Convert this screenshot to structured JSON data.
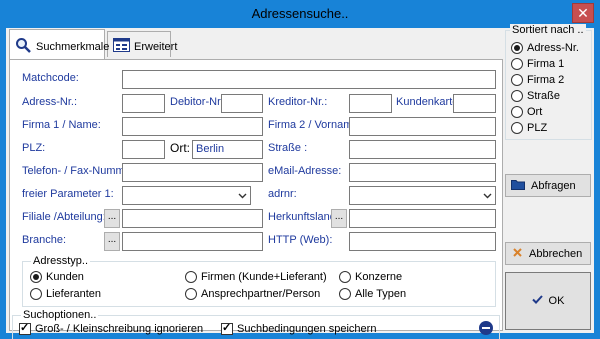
{
  "window": {
    "title": "Adressensuche..",
    "close_symbol": "✕"
  },
  "tabs": [
    {
      "label": "Suchmerkmale",
      "icon": "search-icon",
      "active": true
    },
    {
      "label": "Erweitert",
      "icon": "form-icon",
      "active": false
    }
  ],
  "form": {
    "matchcode_label": "Matchcode:",
    "adressnr_label": "Adress-Nr.:",
    "debitor_label": "Debitor-Nr:",
    "kreditor_label": "Kreditor-Nr.:",
    "kundenkarte_label": "Kundenkarte:",
    "firma1_label": "Firma 1 / Name:",
    "firma2_label": "Firma 2 / Vorname:",
    "plz_label": "PLZ:",
    "ort_label": "Ort:",
    "ort_value": "Berlin",
    "strasse_label": "Straße :",
    "telefon_label": "Telefon- / Fax-Nummer:",
    "email_label": "eMail-Adresse:",
    "freier_label": "freier Parameter 1:",
    "adrnr_label": "adrnr:",
    "filiale_label": "Filiale /Abteilung:",
    "herkunft_label": "Herkunftsland:",
    "branche_label": "Branche:",
    "http_label": "HTTP (Web):",
    "dots": "..."
  },
  "adresstyp": {
    "title": "Adresstyp..",
    "options": [
      {
        "label": "Kunden",
        "selected": true
      },
      {
        "label": "Firmen (Kunde+Lieferant)",
        "selected": false
      },
      {
        "label": "Konzerne",
        "selected": false
      },
      {
        "label": "Lieferanten",
        "selected": false
      },
      {
        "label": "Ansprechpartner/Person",
        "selected": false
      },
      {
        "label": "Alle Typen",
        "selected": false
      }
    ]
  },
  "suchoptionen": {
    "title": "Suchoptionen..",
    "ignore_case_label": "Groß- / Kleinschreibung ignorieren",
    "ignore_case_checked": true,
    "save_conditions_label": "Suchbedingungen speichern",
    "save_conditions_checked": true
  },
  "sortiert": {
    "title": "Sortiert nach ..",
    "options": [
      {
        "label": "Adress-Nr.",
        "selected": true
      },
      {
        "label": "Firma 1",
        "selected": false
      },
      {
        "label": "Firma 2",
        "selected": false
      },
      {
        "label": "Straße",
        "selected": false
      },
      {
        "label": "Ort",
        "selected": false
      },
      {
        "label": "PLZ",
        "selected": false
      }
    ]
  },
  "buttons": {
    "abfragen": "Abfragen",
    "abbrechen": "Abbrechen",
    "ok": "OK"
  }
}
